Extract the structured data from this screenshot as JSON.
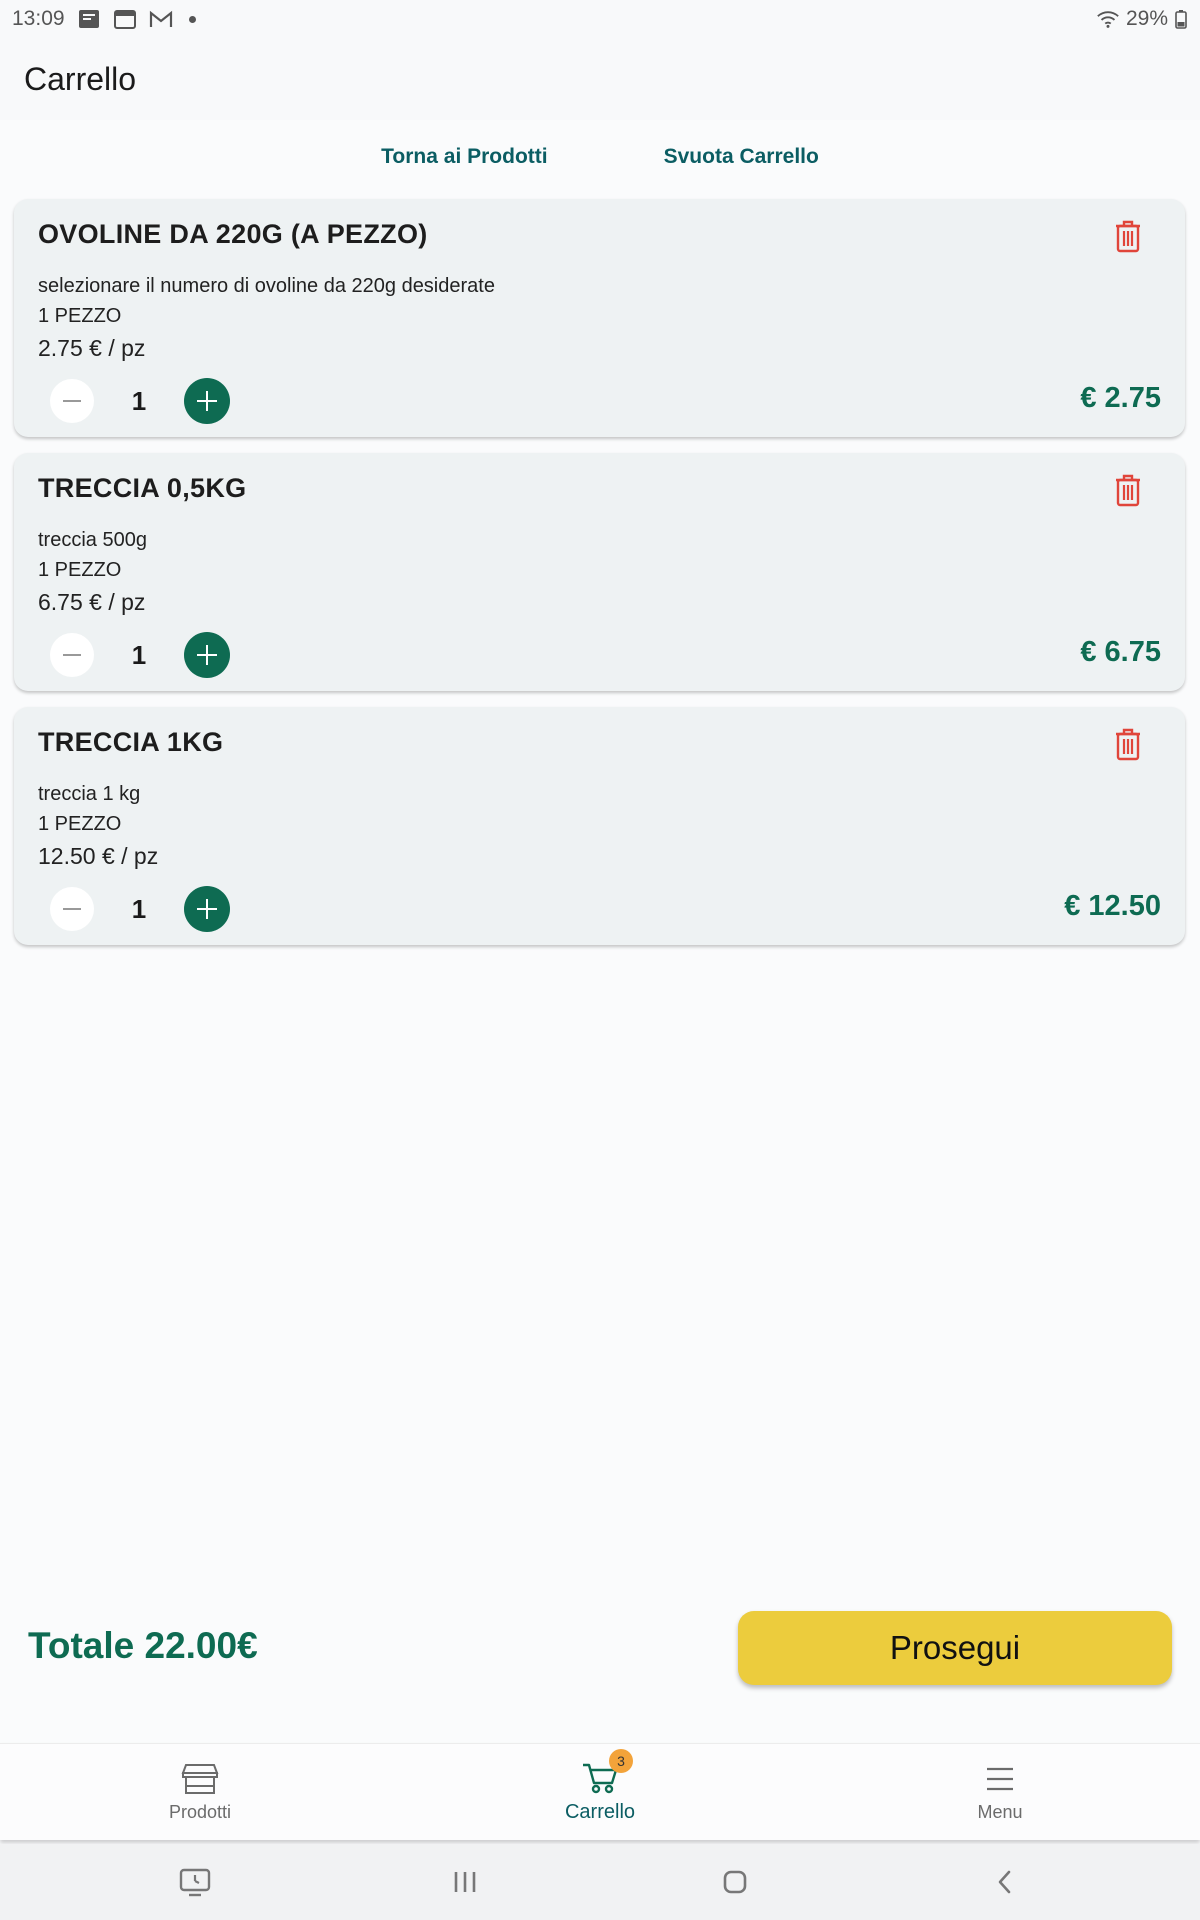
{
  "status_bar": {
    "time": "13:09",
    "battery": "29%",
    "icons": [
      "notification-icon",
      "calendar-icon",
      "gmail-icon",
      "dot-icon",
      "wifi-icon",
      "battery-icon"
    ]
  },
  "app_bar": {
    "title": "Carrello"
  },
  "actions": {
    "back_to_products": "Torna ai Prodotti",
    "empty_cart": "Svuota Carrello"
  },
  "cart": {
    "items": [
      {
        "title": "OVOLINE DA 220G (A PEZZO)",
        "description": "selezionare il numero di ovoline da 220g desiderate",
        "unit": "1 PEZZO",
        "price_per_unit": "2.75 € / pz",
        "quantity": "1",
        "line_total": "€ 2.75"
      },
      {
        "title": "TRECCIA 0,5KG",
        "description": "treccia 500g",
        "unit": "1 PEZZO",
        "price_per_unit": "6.75 € / pz",
        "quantity": "1",
        "line_total": "€ 6.75"
      },
      {
        "title": "TRECCIA 1KG",
        "description": "treccia 1 kg",
        "unit": "1 PEZZO",
        "price_per_unit": "12.50 € / pz",
        "quantity": "1",
        "line_total": "€ 12.50"
      }
    ]
  },
  "footer": {
    "total": "Totale 22.00€",
    "proceed": "Prosegui"
  },
  "bottom_nav": {
    "items": [
      {
        "label": "Prodotti",
        "icon": "store-icon"
      },
      {
        "label": "Carrello",
        "icon": "cart-icon",
        "badge": "3"
      },
      {
        "label": "Menu",
        "icon": "menu-icon"
      }
    ],
    "active": "Carrello"
  },
  "colors": {
    "accent_green": "#0e6b52",
    "link_teal": "#0b5d63",
    "trash_red": "#e0453a",
    "proceed_yellow": "#eccc3d",
    "badge_orange": "#f3a33a",
    "card_bg": "#eef2f3"
  }
}
